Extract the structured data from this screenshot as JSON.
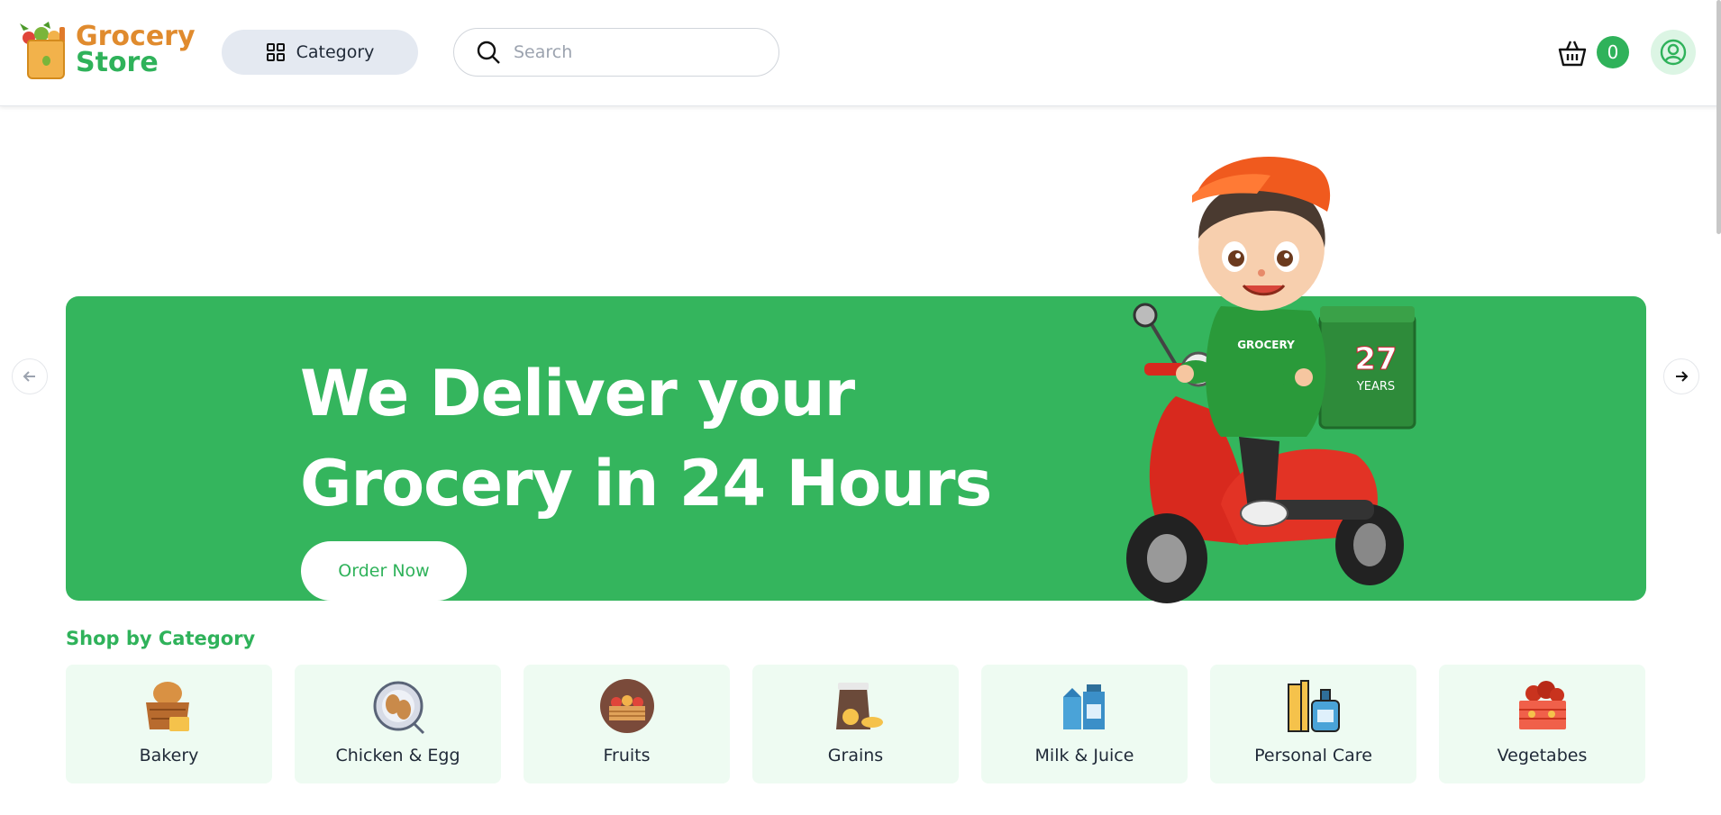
{
  "header": {
    "logo": {
      "line1": "Grocery",
      "line2": "Store"
    },
    "category_label": "Category",
    "search_placeholder": "Search",
    "cart_count": "0"
  },
  "hero": {
    "title_line1": "We Deliver your",
    "title_line2": "Grocery in 24 Hours",
    "cta_label": "Order Now",
    "box_text": "27",
    "box_subtext": "YEARS",
    "hoodie_text": "GROCERY"
  },
  "categories": {
    "title": "Shop by Category",
    "items": [
      {
        "label": "Bakery",
        "icon": "bakery-basket-icon"
      },
      {
        "label": "Chicken & Egg",
        "icon": "chicken-plate-icon"
      },
      {
        "label": "Fruits",
        "icon": "fruit-crate-icon"
      },
      {
        "label": "Grains",
        "icon": "grain-sack-icon"
      },
      {
        "label": "Milk & Juice",
        "icon": "milk-carton-icon"
      },
      {
        "label": "Personal Care",
        "icon": "personal-care-bottles-icon"
      },
      {
        "label": "Vegetabes",
        "icon": "vegetable-crate-icon"
      }
    ]
  },
  "colors": {
    "brand_green": "#34b55d",
    "brand_orange": "#e08b2e",
    "category_bg": "#eefbf2"
  }
}
